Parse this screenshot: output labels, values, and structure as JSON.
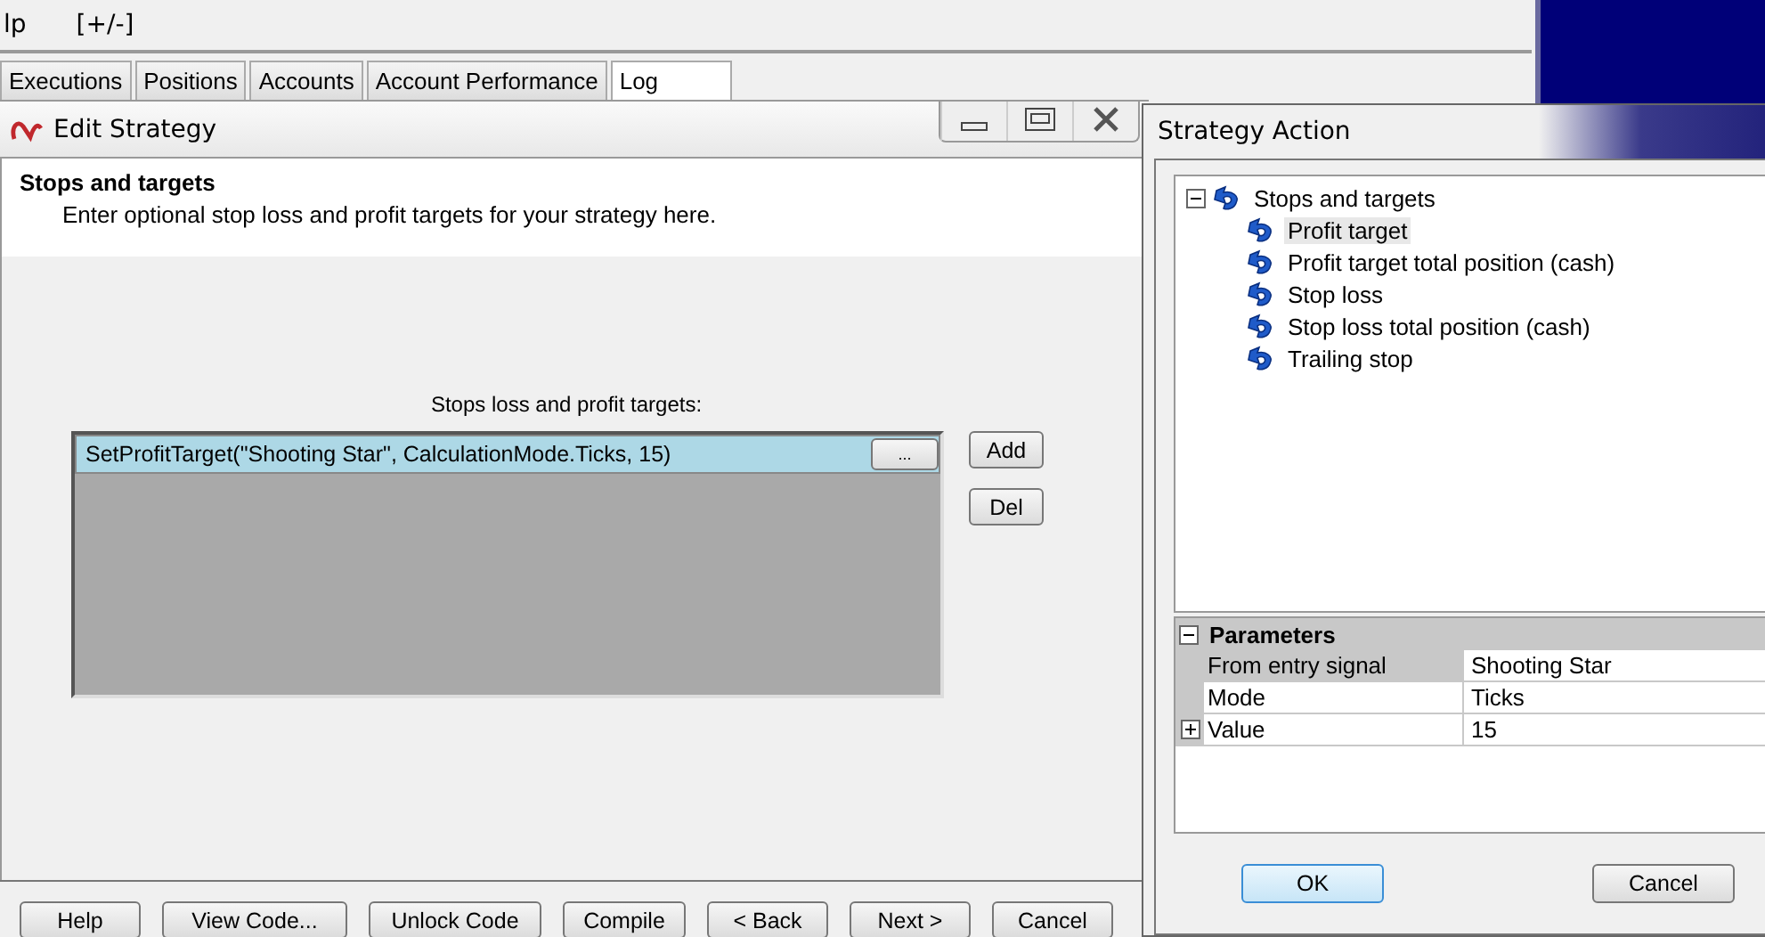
{
  "background_app": {
    "menu": [
      "lp",
      "[+/-]"
    ],
    "tabs": [
      {
        "label": "Executions",
        "selected": false
      },
      {
        "label": "Positions",
        "selected": false
      },
      {
        "label": "Accounts",
        "selected": false
      },
      {
        "label": "Account Performance",
        "selected": false
      },
      {
        "label": "Log",
        "selected": true
      }
    ]
  },
  "edit_strategy": {
    "title": "Edit Strategy",
    "heading": "Stops and targets",
    "description": "Enter optional stop loss and profit targets for your strategy here.",
    "list_label": "Stops loss and profit targets:",
    "entries": [
      {
        "text": "SetProfitTarget(\"Shooting Star\", CalculationMode.Ticks, 15)",
        "selected": true,
        "button": "..."
      }
    ],
    "side_buttons": [
      "Add",
      "Del"
    ],
    "buttons": [
      "Help",
      "View Code...",
      "Unlock Code",
      "Compile",
      "< Back",
      "Next >",
      "Cancel"
    ]
  },
  "strategy_action": {
    "title": "Strategy Action",
    "tree": [
      {
        "label": "Stops and targets",
        "expanded": true,
        "selected": false,
        "children": [
          {
            "label": "Profit target",
            "selected": true
          },
          {
            "label": "Profit target total position (cash)",
            "selected": false
          },
          {
            "label": "Stop loss",
            "selected": false
          },
          {
            "label": "Stop loss total position (cash)",
            "selected": false
          },
          {
            "label": "Trailing stop",
            "selected": false
          }
        ]
      }
    ],
    "parameters": {
      "title": "Parameters",
      "expanded": true,
      "rows": [
        {
          "name": "From entry signal",
          "value": "Shooting Star",
          "selected": true,
          "kind": "field"
        },
        {
          "name": "Mode",
          "value": "Ticks",
          "selected": false,
          "kind": "field"
        },
        {
          "name": "Value",
          "value": "15",
          "selected": false,
          "kind": "group"
        }
      ]
    },
    "buttons": [
      {
        "label": "OK",
        "default": true
      },
      {
        "label": "Cancel",
        "default": false
      }
    ]
  }
}
